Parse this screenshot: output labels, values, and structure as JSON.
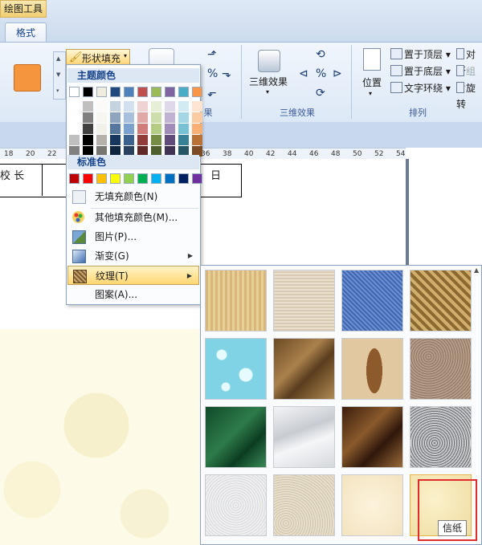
{
  "ribbon": {
    "contextual_tab": "绘图工具",
    "active_tab": "格式",
    "shape_fill_label": "形状填充",
    "groups": {
      "shadow_effects_partial": "果",
      "three_d_effects": "三维效果",
      "arrange": "排列"
    },
    "three_d_button": "三维效果",
    "position_button": "位置",
    "arrange_items": [
      "置于顶层",
      "置于底层",
      "文字环绕"
    ],
    "arrange_items_right": [
      "对齐",
      "组合",
      "旋转"
    ],
    "accent_color": "#f5963e"
  },
  "ruler": {
    "ticks": [
      "18",
      "20",
      "22",
      "36",
      "38",
      "40",
      "42",
      "44",
      "46",
      "48",
      "50",
      "52",
      "54"
    ]
  },
  "document": {
    "cell_text": "校 长",
    "cell_text_right": "日"
  },
  "fill_menu": {
    "theme_colors_header": "主题颜色",
    "standard_colors_header": "标准色",
    "theme_colors": [
      "#ffffff",
      "#000000",
      "#eeece1",
      "#1f497d",
      "#4f81bd",
      "#c0504d",
      "#9bbb59",
      "#8064a2",
      "#4bacc6",
      "#f79646"
    ],
    "standard_colors": [
      "#c00000",
      "#ff0000",
      "#ffc000",
      "#ffff00",
      "#92d050",
      "#00b050",
      "#00b0f0",
      "#0070c0",
      "#002060",
      "#7030a0"
    ],
    "items": [
      {
        "label": "无填充颜色(N)",
        "icon": "no-fill-icon"
      },
      {
        "label": "其他填充颜色(M)...",
        "icon": "palette-icon"
      },
      {
        "label": "图片(P)...",
        "icon": "picture-icon"
      },
      {
        "label": "渐变(G)",
        "icon": "gradient-icon",
        "submenu": true
      },
      {
        "label": "纹理(T)",
        "icon": "texture-icon",
        "submenu": true,
        "active": true
      },
      {
        "label": "图案(A)...",
        "icon": "pattern-icon"
      }
    ]
  },
  "texture_panel": {
    "tooltip": "信纸",
    "textures": [
      "papyrus",
      "canvas",
      "denim",
      "woven-mat",
      "water-droplets",
      "paper-bag",
      "fish-fossil",
      "sand",
      "green-marble",
      "white-marble",
      "brown-marble",
      "granite",
      "newsprint",
      "recycled-paper",
      "parchment",
      "stationery"
    ],
    "selected": "stationery"
  }
}
